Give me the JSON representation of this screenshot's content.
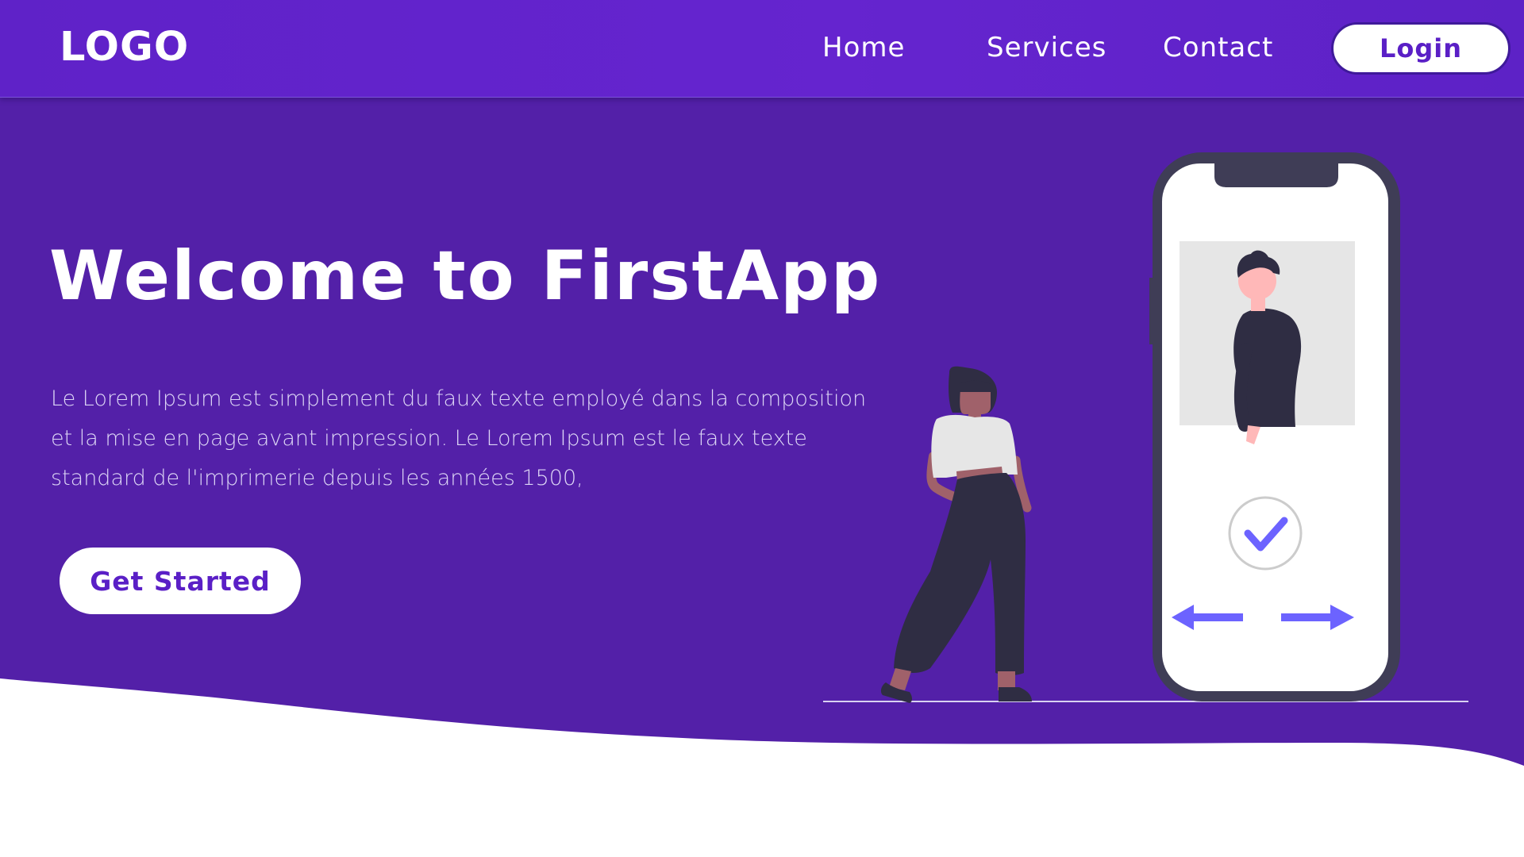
{
  "colors": {
    "nav_bg": "#6224cc",
    "hero_bg": "#5320a8",
    "accent": "#6c63ff",
    "button_text": "#5a1fc6",
    "white": "#ffffff"
  },
  "navbar": {
    "logo": "LOGO",
    "links": [
      "Home",
      "Services",
      "Contact"
    ],
    "login_label": "Login"
  },
  "hero": {
    "title": "Welcome to FirstApp",
    "description": "Le Lorem Ipsum est simplement du faux texte employé dans la composition\net la mise en page avant impression. Le Lorem Ipsum est le faux texte\n standard de l'imprimerie depuis les années 1500,",
    "cta_label": "Get Started"
  },
  "illustration": {
    "icons": [
      "woman-figure-icon",
      "phone-icon",
      "profile-photo-icon",
      "check-circle-icon",
      "arrow-left-icon",
      "arrow-right-icon"
    ]
  }
}
